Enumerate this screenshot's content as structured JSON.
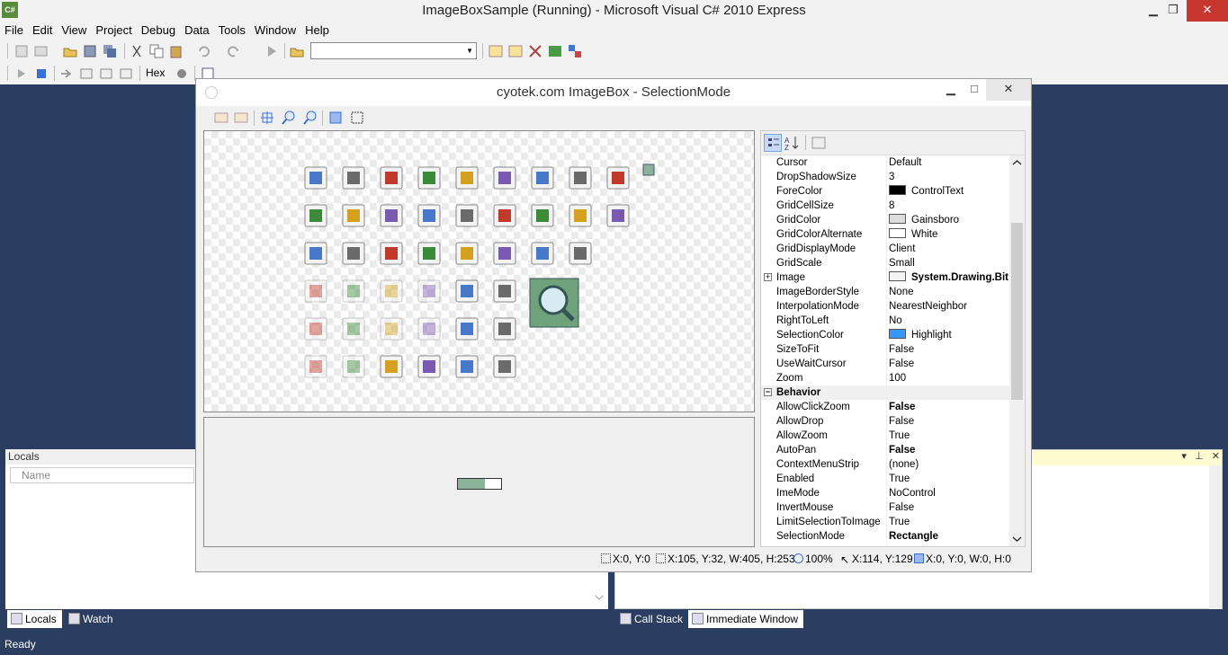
{
  "window": {
    "title": "ImageBoxSample (Running) - Microsoft Visual C# 2010 Express",
    "logo": "C#",
    "minimize_glyph": "▁",
    "restore_glyph": "❐",
    "close_glyph": "✕"
  },
  "menu": [
    "File",
    "Edit",
    "View",
    "Project",
    "Debug",
    "Data",
    "Tools",
    "Window",
    "Help"
  ],
  "debug_toolbar": {
    "hex_label": "Hex"
  },
  "status": {
    "text": "Ready"
  },
  "locals": {
    "title": "Locals",
    "column_name": "Name",
    "tabs": [
      "Locals",
      "Watch"
    ]
  },
  "bottom_right_tabs": [
    "Call Stack",
    "Immediate Window"
  ],
  "dialog": {
    "title": "cyotek.com ImageBox - SelectionMode",
    "status": {
      "cursor": "X:0, Y:0",
      "visible": "X:105, Y:32, W:405, H:253",
      "zoom": "100%",
      "mouse": "X:114, Y:129",
      "selection": "X:0, Y:0, W:0, H:0"
    }
  },
  "properties": {
    "rows": [
      {
        "name": "Cursor",
        "value": "Default"
      },
      {
        "name": "DropShadowSize",
        "value": "3"
      },
      {
        "name": "ForeColor",
        "value": "ControlText",
        "color": "#000000"
      },
      {
        "name": "GridCellSize",
        "value": "8"
      },
      {
        "name": "GridColor",
        "value": "Gainsboro",
        "color": "#dcdcdc"
      },
      {
        "name": "GridColorAlternate",
        "value": "White",
        "color": "#ffffff"
      },
      {
        "name": "GridDisplayMode",
        "value": "Client"
      },
      {
        "name": "GridScale",
        "value": "Small"
      },
      {
        "name": "Image",
        "value": "System.Drawing.Bit",
        "bold": true,
        "expandable": true
      },
      {
        "name": "ImageBorderStyle",
        "value": "None"
      },
      {
        "name": "InterpolationMode",
        "value": "NearestNeighbor"
      },
      {
        "name": "RightToLeft",
        "value": "No"
      },
      {
        "name": "SelectionColor",
        "value": "Highlight",
        "color": "#3399ff"
      },
      {
        "name": "SizeToFit",
        "value": "False"
      },
      {
        "name": "UseWaitCursor",
        "value": "False"
      },
      {
        "name": "Zoom",
        "value": "100"
      },
      {
        "name": "Behavior",
        "category": true
      },
      {
        "name": "AllowClickZoom",
        "value": "False",
        "bold": true
      },
      {
        "name": "AllowDrop",
        "value": "False"
      },
      {
        "name": "AllowZoom",
        "value": "True"
      },
      {
        "name": "AutoPan",
        "value": "False",
        "bold": true
      },
      {
        "name": "ContextMenuStrip",
        "value": "(none)"
      },
      {
        "name": "Enabled",
        "value": "True"
      },
      {
        "name": "ImeMode",
        "value": "NoControl"
      },
      {
        "name": "InvertMouse",
        "value": "False"
      },
      {
        "name": "LimitSelectionToImage",
        "value": "True"
      },
      {
        "name": "SelectionMode",
        "value": "Rectangle",
        "bold": true
      }
    ]
  },
  "icons": [
    "binoculars-icon",
    "camera-icon",
    "eyedropper-icon",
    "user-card-icon",
    "printer-icon",
    "binoculars-icon",
    "tree-list-icon",
    "image-resize-icon",
    "edit-icon",
    "small-image-icon",
    "database-info-icon",
    "play-icon",
    "tree-list-icon",
    "notepad-icon",
    "checklist-icon",
    "camera-icon",
    "user-card-icon",
    "printer-icon",
    "save-icon",
    "binary-download-icon",
    "spellcheck-icon",
    "image-resize-icon",
    "save-text-icon",
    "eyedropper-icon",
    "database-info-icon",
    "zoom-icon",
    "checklist-icon"
  ]
}
